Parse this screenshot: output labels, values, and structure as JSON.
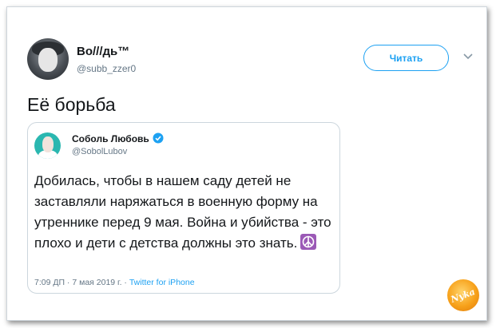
{
  "tweet": {
    "author_name": "Во///дь™",
    "author_handle": "@subb_zzer0",
    "follow_label": "Читать",
    "text": "Её борьба"
  },
  "quoted": {
    "name": "Соболь Любовь",
    "handle": "@SobolLubov",
    "text": "Добилась, чтобы в нашем саду детей не заставляли наряжаться в военную форму на утреннике перед 9 мая. Война и убийства - это плохо и дети с детства должны это знать.",
    "time": "7:09 ДП · 7 мая 2019 г. · ",
    "source": "Twitter for iPhone",
    "emoji_icon": "peace-symbol-icon"
  },
  "watermark": {
    "text": "Nyka"
  },
  "colors": {
    "accent": "#1da1f2",
    "text": "#14171a",
    "secondary": "#657786",
    "emoji_bg": "#9b59b6"
  }
}
